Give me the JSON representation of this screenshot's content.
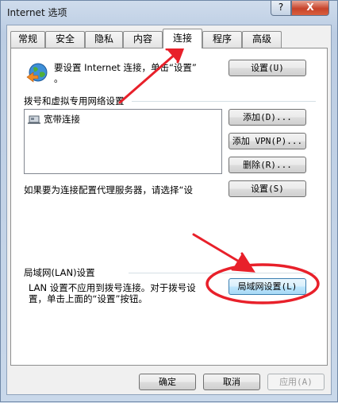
{
  "window": {
    "title": "Internet 选项",
    "help_label": "?",
    "close_label": "X"
  },
  "tabs": [
    {
      "label": "常规"
    },
    {
      "label": "安全"
    },
    {
      "label": "隐私"
    },
    {
      "label": "内容"
    },
    {
      "label": "连接"
    },
    {
      "label": "程序"
    },
    {
      "label": "高级"
    }
  ],
  "connection": {
    "setup_text_line1": "要设置 Internet 连接，单击“设置”",
    "setup_text_line2": "。",
    "setup_button": "设置(U)",
    "dialup_group": "拨号和虚拟专用网络设置",
    "list_items": [
      {
        "label": "宽带连接"
      }
    ],
    "add_button": "添加(D)...",
    "add_vpn_button": "添加 VPN(P)...",
    "remove_button": "删除(R)...",
    "proxy_text": "如果要为连接配置代理服务器，请选择“设",
    "settings_button": "设置(S)",
    "lan_group": "局域网(LAN)设置",
    "lan_text_line1": "LAN 设置不应用到拨号连接。对于拨号设",
    "lan_text_line2": "置，单击上面的“设置”按钮。",
    "lan_button": "局域网设置(L)"
  },
  "footer": {
    "ok_button": "确定",
    "cancel_button": "取消",
    "apply_button": "应用(A)"
  },
  "colors": {
    "annotation_red": "#e8202a",
    "title_gradient": "#bccde3"
  }
}
